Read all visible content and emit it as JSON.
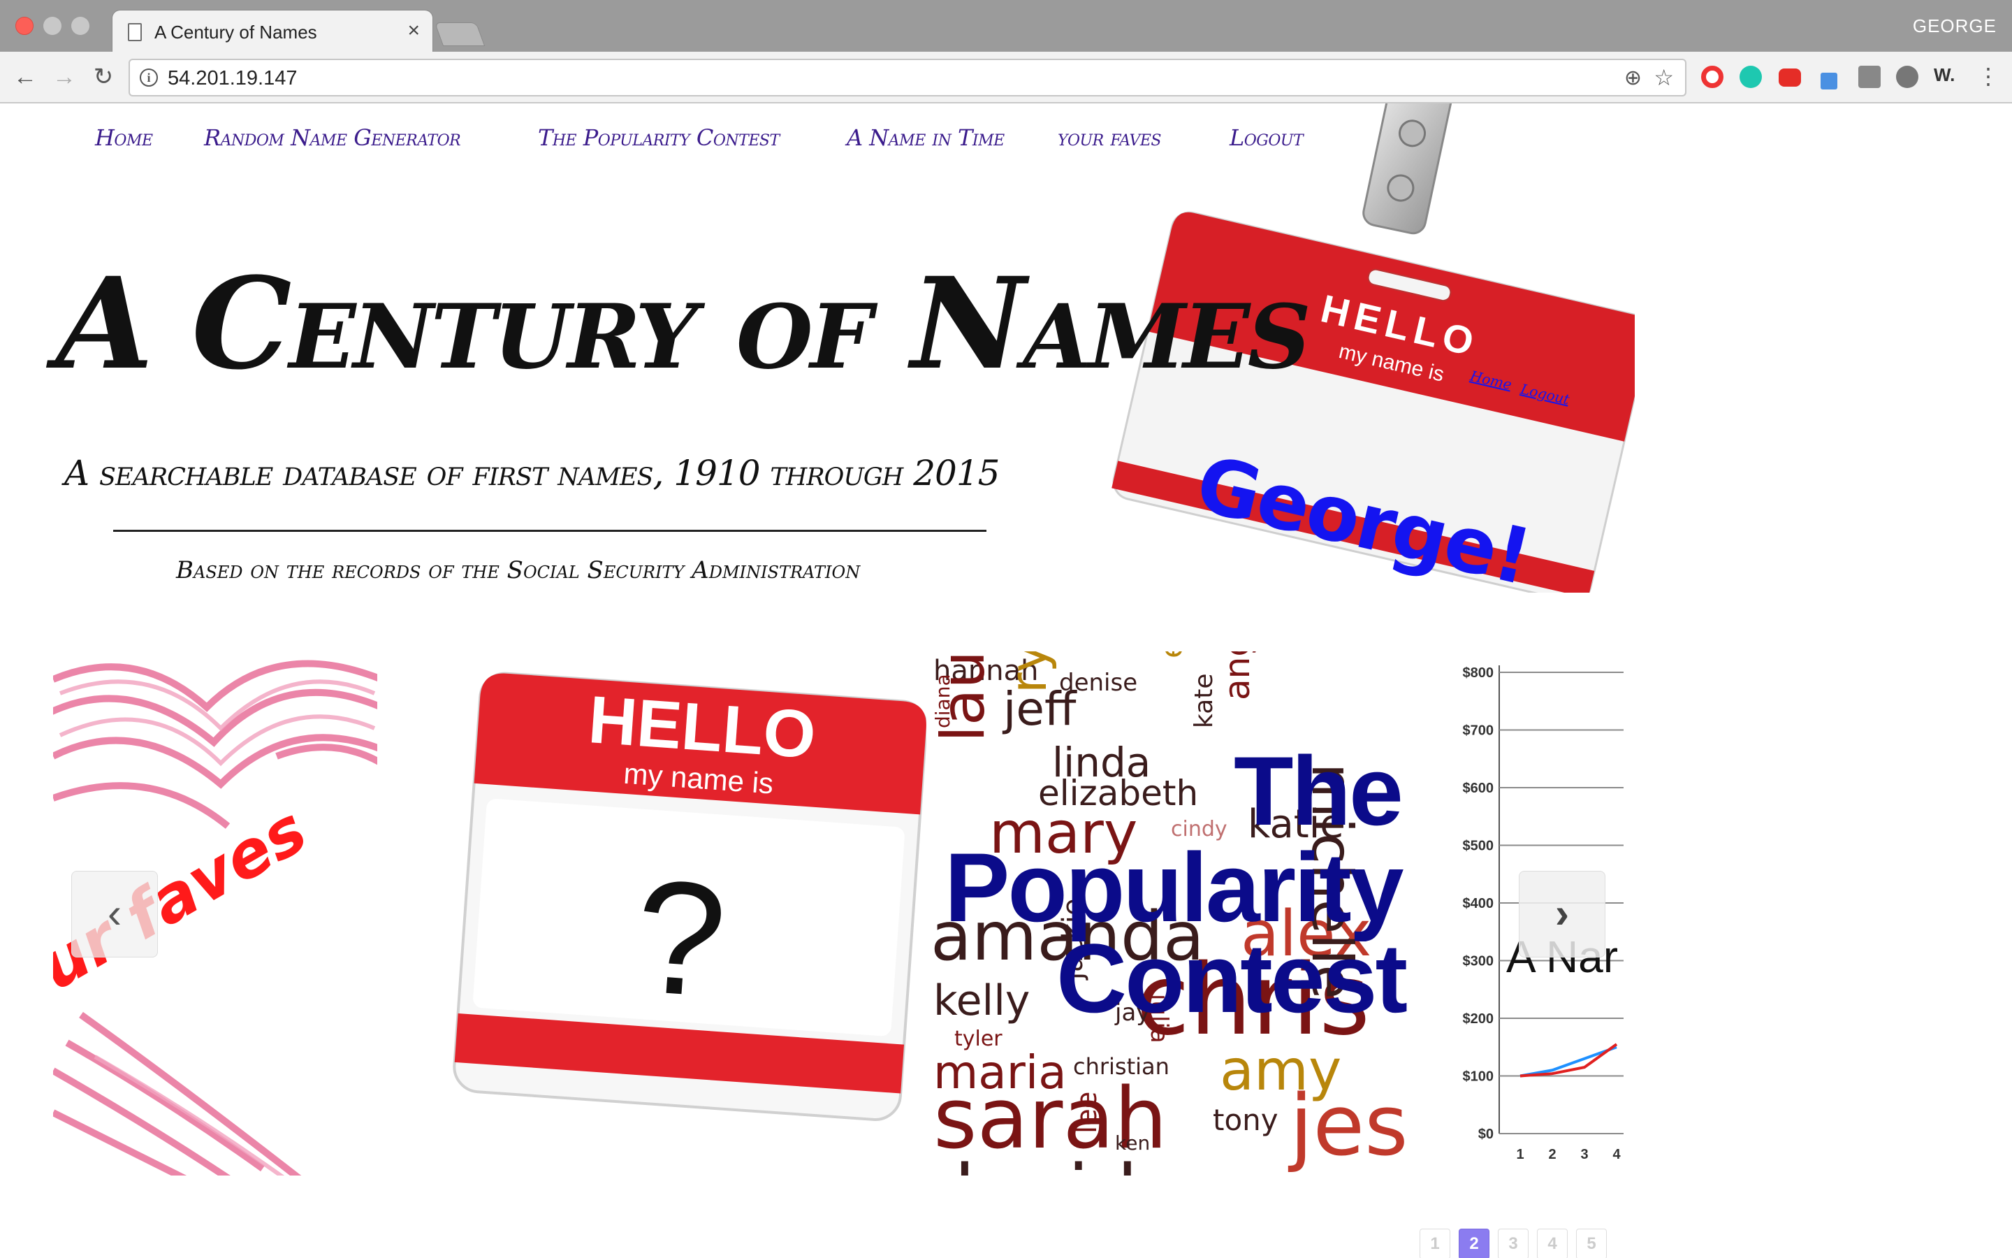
{
  "browser": {
    "tab_title": "A Century of Names",
    "tab_close": "×",
    "profile_name": "GEORGE",
    "url": "54.201.19.147",
    "nav_back": "←",
    "nav_forward": "→",
    "nav_reload": "↻",
    "info_glyph": "i",
    "zoom_glyph": "⊕",
    "star_glyph": "☆",
    "ext_w_label": "W.",
    "menu_glyph": "⋮"
  },
  "nav": {
    "items": [
      {
        "label": "Home"
      },
      {
        "label": "Random Name Generator"
      },
      {
        "label": "The Popularity Contest"
      },
      {
        "label": "A Name in Time"
      },
      {
        "label": "your faves"
      },
      {
        "label": "Logout"
      }
    ]
  },
  "header": {
    "title": "A Century of Names",
    "tagline": "A searchable database of first names, 1910 through 2015",
    "subtag": "Based on the records of the Social Security Administration"
  },
  "badge": {
    "hello": "HELLO",
    "my_name_is": "my name is",
    "name": "George!",
    "home_link": "Home",
    "logout_link": "Logout"
  },
  "carousel": {
    "faves_label": "ur faves",
    "random_hello": "HELLO",
    "random_my_name_is": "my name is",
    "random_question": "?",
    "pop_title_1": "The",
    "pop_title_2": "Popularity",
    "pop_title_3": "Contest",
    "time_title": "A Nar",
    "prev_glyph": "‹",
    "next_glyph": "›",
    "pages": [
      "1",
      "2",
      "3",
      "4",
      "5"
    ],
    "active_page": 2,
    "cloud_words": [
      {
        "t": "hannah",
        "c": "#3a1c1c"
      },
      {
        "t": "denise",
        "c": "#3a1c1c"
      },
      {
        "t": "jeff",
        "c": "#3a1c1c"
      },
      {
        "t": "emma",
        "c": "#b8860b"
      },
      {
        "t": "ryan",
        "c": "#b8860b"
      },
      {
        "t": "kate",
        "c": "#3a1c1c"
      },
      {
        "t": "angela",
        "c": "#7a1414"
      },
      {
        "t": "diana",
        "c": "#7a1414"
      },
      {
        "t": "laura",
        "c": "#7a1414"
      },
      {
        "t": "linda",
        "c": "#3a1c1c"
      },
      {
        "t": "elizabeth",
        "c": "#3a1c1c"
      },
      {
        "t": "mary",
        "c": "#7a1414"
      },
      {
        "t": "cindy",
        "c": "#c07070"
      },
      {
        "t": "katie",
        "c": "#3a1c1c"
      },
      {
        "t": "amanda",
        "c": "#3a1c1c"
      },
      {
        "t": "alex",
        "c": "#c0392b"
      },
      {
        "t": "kelly",
        "c": "#3a1c1c"
      },
      {
        "t": "chris",
        "c": "#7a1414"
      },
      {
        "t": "tyler",
        "c": "#7a1414"
      },
      {
        "t": "maria",
        "c": "#7a1414"
      },
      {
        "t": "christian",
        "c": "#3a1c1c"
      },
      {
        "t": "amy",
        "c": "#b8860b"
      },
      {
        "t": "sarah",
        "c": "#7a1414"
      },
      {
        "t": "tony",
        "c": "#3a1c1c"
      },
      {
        "t": "jes",
        "c": "#c0392b"
      },
      {
        "t": "michelle",
        "c": "#3a1c1c"
      },
      {
        "t": "lee",
        "c": "#7a1414"
      },
      {
        "t": "ken",
        "c": "#3a1c1c"
      },
      {
        "t": "david",
        "c": "#3a1c1c"
      },
      {
        "t": "jackie",
        "c": "#3a1c1c"
      },
      {
        "t": "jay",
        "c": "#3a1c1c"
      },
      {
        "t": "julia",
        "c": "#7a1414"
      }
    ]
  },
  "chart_data": {
    "type": "line",
    "x": [
      1,
      2,
      3,
      4
    ],
    "ytick_labels": [
      "$800",
      "$700",
      "$600",
      "$500",
      "$400",
      "$300",
      "$200",
      "$100",
      "$0"
    ],
    "xtick_labels": [
      "1",
      "2",
      "3",
      "4"
    ],
    "ylim": [
      0,
      800
    ],
    "series": [
      {
        "color": "#1e90ff",
        "values": [
          100,
          110,
          130,
          150
        ]
      },
      {
        "color": "#e02020",
        "values": [
          100,
          104,
          115,
          155
        ]
      }
    ]
  }
}
